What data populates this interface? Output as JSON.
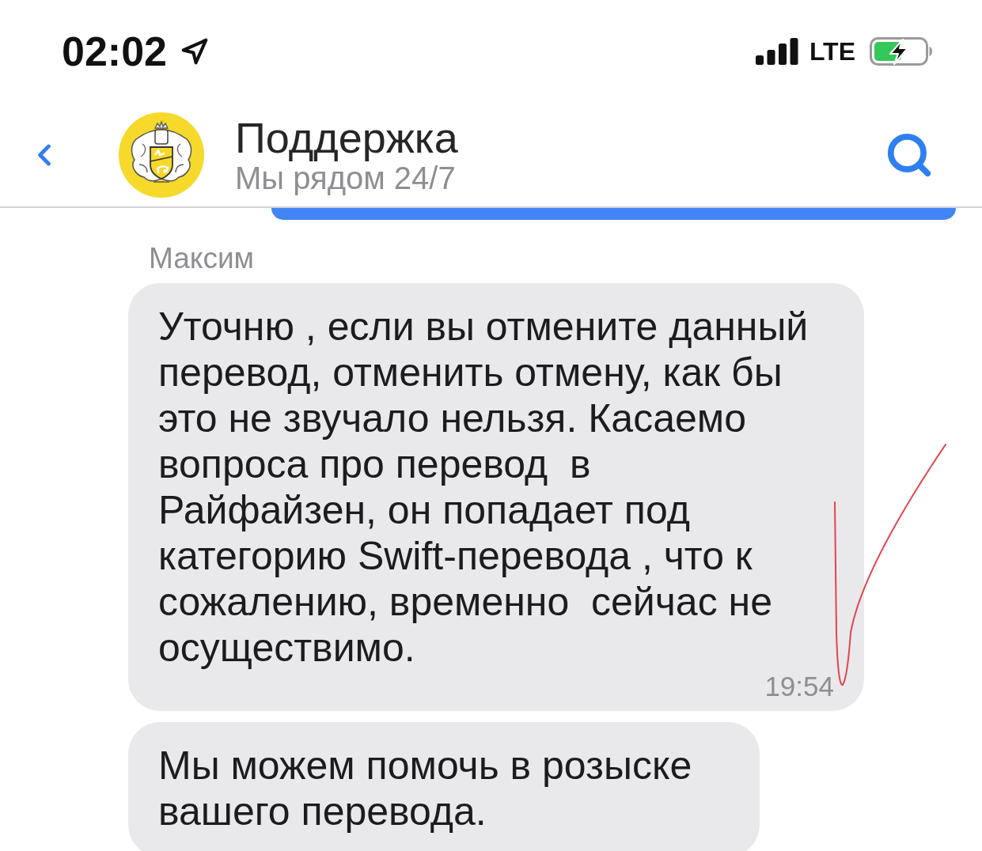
{
  "status_bar": {
    "time": "02:02",
    "network": "LTE"
  },
  "header": {
    "title": "Поддержка",
    "subtitle": "Мы рядом 24/7"
  },
  "sender": "Максим",
  "messages": [
    {
      "text": "Уточню , если вы отмените данный\nперевод, отменить отмену, как бы\nэто не звучало нельзя. Касаемо\nвопроса про перевод  в\nРайфайзен, он попадает под\nкатегорию Swift-перевода , что к\nсожалению, временно  сейчас не\nосуществимо.",
      "time": "19:54"
    },
    {
      "text": "Мы можем помочь в розыске\nвашего перевода."
    }
  ]
}
